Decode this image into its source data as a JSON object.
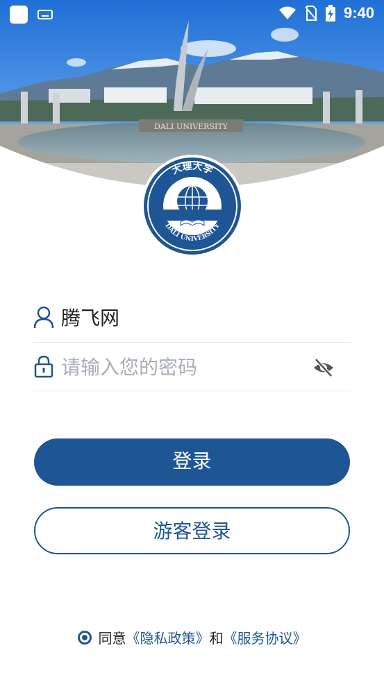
{
  "status_bar": {
    "time": "9:40",
    "icons": [
      "app-square-icon",
      "keyboard-icon",
      "wifi-icon",
      "no-sim-icon",
      "battery-charging-icon"
    ]
  },
  "header": {
    "banner_sign_text": "DALI UNIVERSITY",
    "logo": {
      "chinese_name": "大理大学",
      "english_name": "DALI UNIVERSITY"
    }
  },
  "login_form": {
    "username_value": "腾飞网",
    "password_placeholder": "请输入您的密码",
    "password_value": ""
  },
  "buttons": {
    "login_label": "登录",
    "guest_login_label": "游客登录"
  },
  "agreement": {
    "agree_text": "同意",
    "privacy_link": "《隐私政策》",
    "conjunction": "和",
    "service_link": "《服务协议》",
    "checked": true
  },
  "colors": {
    "primary": "#1e5594",
    "placeholder": "#a9aeb6",
    "divider": "#e6e8ec"
  }
}
